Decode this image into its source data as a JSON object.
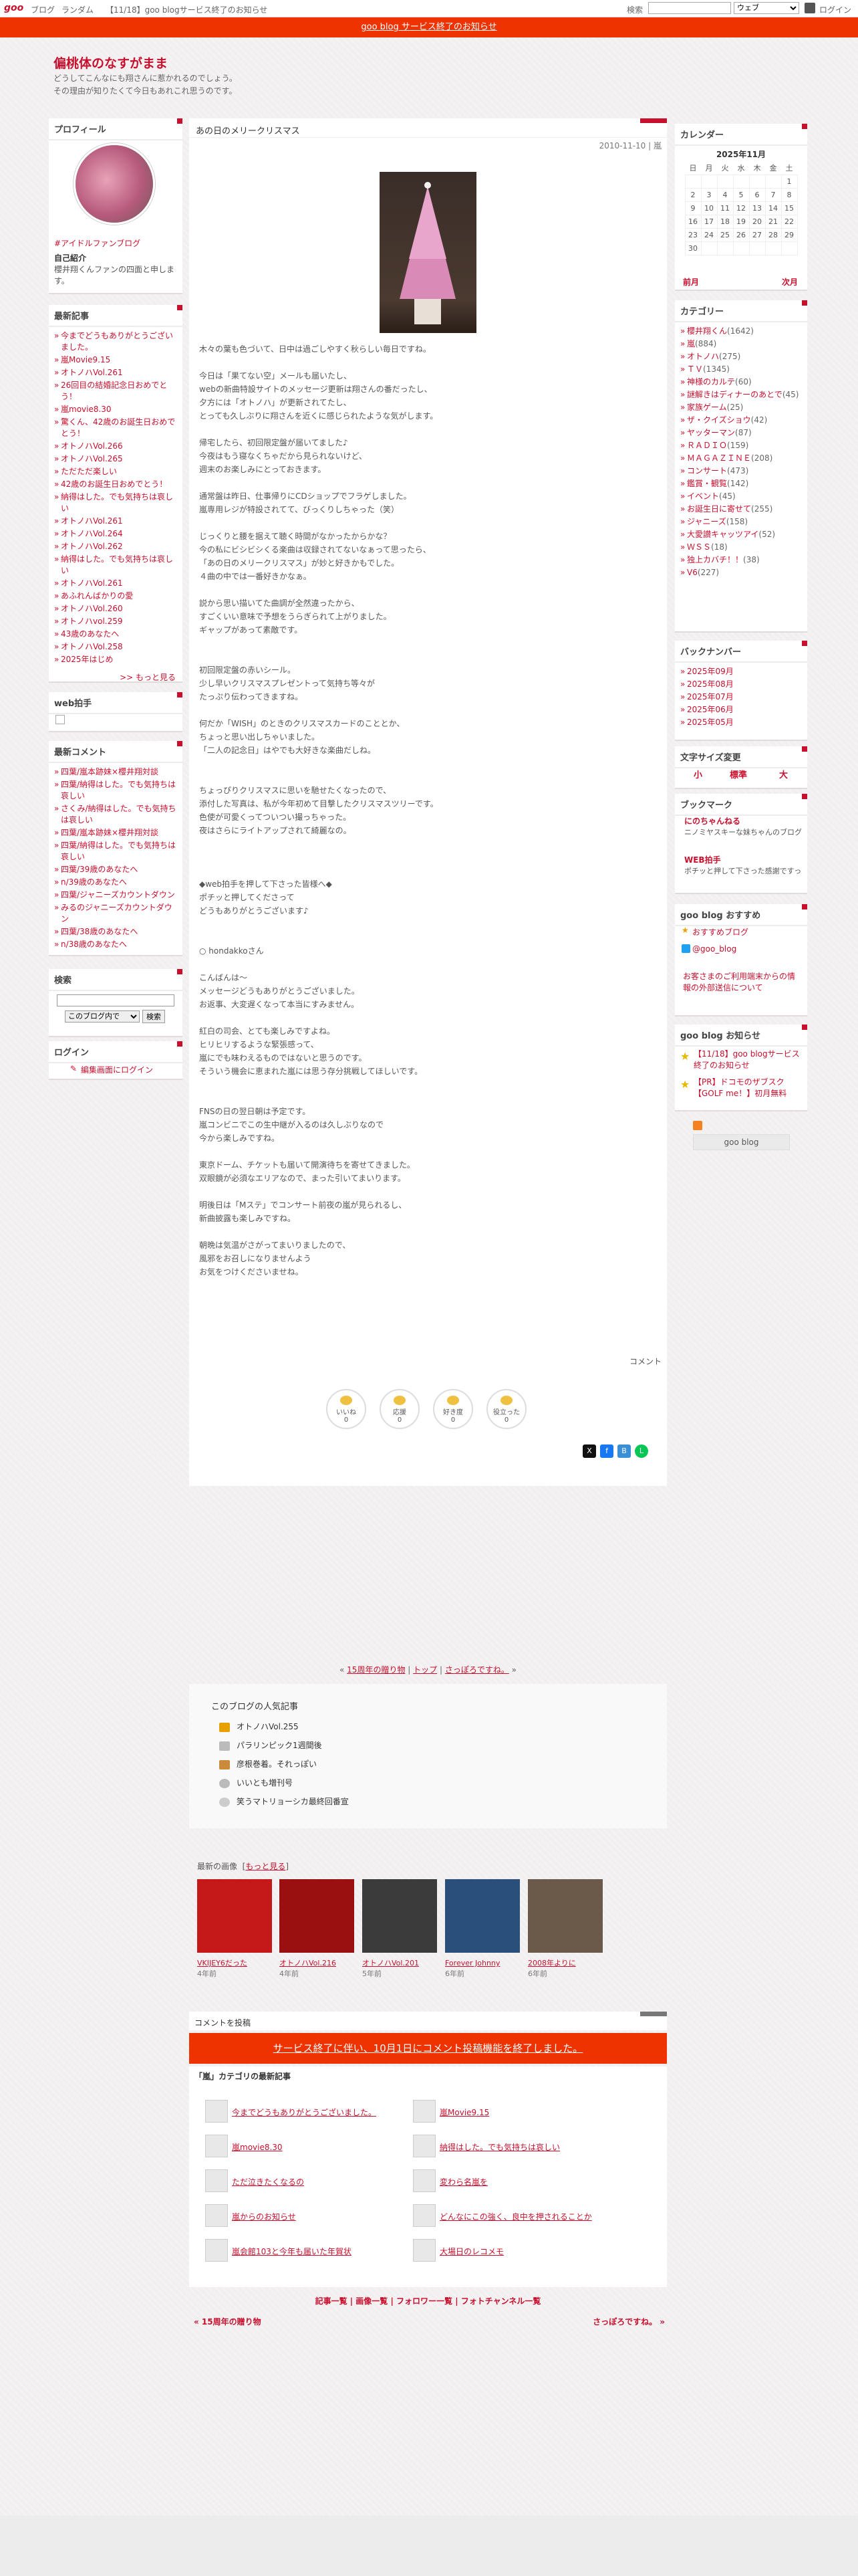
{
  "topbar": {
    "logo": "goo",
    "links": [
      "ブログ",
      "ランダム",
      "【11/18】goo blogサービス終了のお知らせ"
    ],
    "search_label": "検索",
    "scope": "ウェブ",
    "login": "ログイン"
  },
  "notice": "goo blog サービス終了のお知らせ",
  "blog": {
    "title": "偏桃体のなすがまま",
    "desc1": "どうしてこんなにも翔さんに惹かれるのでしょう。",
    "desc2": "その理由が知りたくて今日もあれこれ思うのです。"
  },
  "profile": {
    "heading": "プロフィール",
    "name": "#アイドルファンブログ",
    "intro_h": "自己紹介",
    "intro": "櫻井翔くんファンの四面と申します。"
  },
  "recent": {
    "heading": "最新記事",
    "items": [
      "今までどうもありがとうございました。",
      "嵐Movie9.15",
      "オトノハVol.261",
      "26回目の結婚記念日おめでとう！",
      "嵐movie8.30",
      "驚くん、42歳のお誕生日おめでとう！",
      "オトノハVol.266",
      "オトノハVol.265",
      "ただただ楽しい",
      "42歳のお誕生日おめでとう！",
      "納得はした。でも気持ちは哀しい",
      "オトノハVol.261",
      "オトノハVol.264",
      "オトノハVol.262",
      "納得はした。でも気持ちは哀しい",
      "オトノハVol.261",
      "あふれんばかりの愛",
      "オトノハVol.260",
      "オトノハvol.259",
      "43歳のあなたへ",
      "オトノハVol.258",
      "2025年はじめ"
    ],
    "more": ">> もっと見る"
  },
  "webclap": {
    "heading": "web拍手"
  },
  "comments": {
    "heading": "最新コメント",
    "items": [
      "四葉/嵐本跡妹×櫻井翔対談",
      "四葉/納得はした。でも気持ちは哀しい",
      "さくみ/納得はした。でも気持ちは哀しい",
      "四葉/嵐本跡妹×櫻井翔対談",
      "四葉/納得はした。でも気持ちは哀しい",
      "四葉/39歳のあなたへ",
      "n/39歳のあなたへ",
      "四葉/ジャニーズカウントダウン",
      "みるのジャニーズカウントダウン",
      "四葉/38歳のあなたへ",
      "n/38歳のあなたへ"
    ]
  },
  "search": {
    "heading": "検索",
    "scope": "このブログ内で",
    "button": "検索"
  },
  "login": {
    "heading": "ログイン",
    "link": "編集画面にログイン"
  },
  "entry": {
    "title": "あの日のメリークリスマス",
    "date": "2010-11-10 | 嵐",
    "body": [
      "木々の葉も色づいて、日中は過ごしやすく秋らしい毎日ですね。",
      "",
      "今日は「果てない空」メールも届いたし、",
      "webの新曲特設サイトのメッセージ更新は翔さんの番だったし、",
      "夕方には「オトノハ」が更新されてたし、",
      "とっても久しぶりに翔さんを近くに感じられたような気がします。",
      "",
      "帰宅したら、初回限定盤が届いてました♪",
      "今夜はもう寝なくちゃだから見られないけど、",
      "週末のお楽しみにとっておきます。",
      "",
      "通常盤は昨日、仕事帰りにCDショップでフラゲしました。",
      "嵐専用レジが特設されてて、びっくりしちゃった（笑）",
      "",
      "じっくりと腰を据えて聴く時間がなかったからかな？",
      "今の私にビシビシくる楽曲は収録されてないなぁって思ったら、",
      "「あの日のメリークリスマス」が妙と好きかもでした。",
      "４曲の中では一番好きかなぁ。",
      "",
      "説から思い描いてた曲調が全然違ったから、",
      "すごくいい意味で予想をうらぎられて上がりました。",
      "ギャップがあって素敵です。",
      "",
      "",
      "初回限定盤の赤いシール。",
      "少し早いクリスマスプレゼントって気持ち等々が",
      "たっぷり伝わってきますね。",
      "",
      "何だか「WISH」のときのクリスマスカードのこととか、",
      "ちょっと思い出しちゃいました。",
      "「二人の記念日」はやでも大好きな楽曲だしね。",
      "",
      "",
      "ちょっぴりクリスマスに思いを馳せたくなったので、",
      "添付した写真は、私が今年初めて目撃したクリスマスツリーです。",
      "色使が可愛くってついつい撮っちゃった。",
      "夜はさらにライトアップされて綺麗なの。",
      "",
      "",
      "",
      "◆web拍手を押して下さった皆様へ◆",
      "ポチッと押してくださって",
      "どうもありがとうございます♪",
      "",
      "",
      "○ hondakkoさん",
      "",
      "こんばんは～",
      "メッセージどうもありがとうございました。",
      "お返事、大変遅くなって本当にすみません。",
      "",
      "紅白の司会、とても楽しみですよね。",
      "ヒリヒリするような緊張感って、",
      "嵐にでも味わえるものではないと思うのです。",
      "そういう機会に恵まれた嵐には思う存分挑戦してほしいです。",
      "",
      "",
      "FNSの日の翌日朝は予定です。",
      "嵐コンビニでこの生中継が入るのは久しぶりなので",
      "今から楽しみですね。",
      "",
      "東京ドーム、チケットも届いて開演待ちを寄せてきました。",
      "双眼鏡が必須なエリアなので、まった引いてまいります。",
      "",
      "明後日は「Mステ」でコンサート前夜の嵐が見られるし、",
      "新曲披露も楽しみですね。",
      "",
      "朝晩は気温がさがってまいりましたので、",
      "風邪をお召しになりませんよう",
      "お気をつけくださいませね。"
    ],
    "comment_link": "コメント",
    "reactions": [
      "いいね",
      "応援",
      "好き度",
      "役立った"
    ],
    "reaction_counts": [
      "0",
      "0",
      "0",
      "0"
    ]
  },
  "pager": {
    "prev": "15周年の贈り物",
    "top": "トップ",
    "next": "さっぽろですね。"
  },
  "popular": {
    "heading": "このブログの人気記事",
    "items": [
      "オトノハVol.255",
      "パラリンピック1週間後",
      "彦根巻着。それっぽい",
      "いいとも増刊号",
      "笑うマトリョーシカ最終回番宣"
    ]
  },
  "images": {
    "heading": "最新の画像",
    "more": "もっと見る",
    "items": [
      {
        "t": "VKIJEY6だった",
        "a": "4年前"
      },
      {
        "t": "オトノハVol.216",
        "a": "4年前"
      },
      {
        "t": "オトノハVol.201",
        "a": "5年前"
      },
      {
        "t": "Forever Johnny",
        "a": "6年前"
      },
      {
        "t": "2008年よりに",
        "a": "6年前"
      }
    ]
  },
  "comment_post": {
    "heading": "コメントを投稿",
    "closed": "サービス終了に伴い、10月1日にコメント投稿機能を終了しました。"
  },
  "latest": {
    "heading": "「嵐」カテゴリの最新記事",
    "items": [
      "今までどうもありがとうございました。",
      "嵐Movie9.15",
      "嵐movie8.30",
      "納得はした。でも気持ちは哀しい",
      "ただ泣きたくなるの",
      "変わら名嵐を",
      "嵐からのお知らせ",
      "どんなにこの強く、良中を押されることか",
      "嵐会館103と今年も届いた年賀状",
      "大場日のレコメモ"
    ]
  },
  "footer": {
    "links": "記事一覧 | 画像一覧 | フォロワー一覧 | フォトチャンネル一覧",
    "prev": "« 15周年の贈り物",
    "next": "さっぽろですね。 »"
  },
  "calendar": {
    "heading": "カレンダー",
    "month": "2025年11月",
    "dow": [
      "日",
      "月",
      "火",
      "水",
      "木",
      "金",
      "土"
    ],
    "rows": [
      [
        "",
        "",
        "",
        "",
        "",
        "",
        "1"
      ],
      [
        "2",
        "3",
        "4",
        "5",
        "6",
        "7",
        "8"
      ],
      [
        "9",
        "10",
        "11",
        "12",
        "13",
        "14",
        "15"
      ],
      [
        "16",
        "17",
        "18",
        "19",
        "20",
        "21",
        "22"
      ],
      [
        "23",
        "24",
        "25",
        "26",
        "27",
        "28",
        "29"
      ],
      [
        "30",
        "",
        "",
        "",
        "",
        "",
        ""
      ]
    ],
    "prev": "前月",
    "next": "次月"
  },
  "categories": {
    "heading": "カテゴリー",
    "items": [
      [
        "櫻井翔くん",
        "1642"
      ],
      [
        "嵐",
        "884"
      ],
      [
        "オトノハ",
        "275"
      ],
      [
        "ＴＶ",
        "1345"
      ],
      [
        "神様のカルテ",
        "60"
      ],
      [
        "謎解きはディナーのあとで",
        "45"
      ],
      [
        "家族ゲーム",
        "25"
      ],
      [
        "ザ・クイズショウ",
        "42"
      ],
      [
        "ヤッターマン",
        "87"
      ],
      [
        "ＲＡＤＩＯ",
        "159"
      ],
      [
        "ＭＡＧＡＺＩＮＥ",
        "208"
      ],
      [
        "コンサート",
        "473"
      ],
      [
        "鑑賞・観覧",
        "142"
      ],
      [
        "イベント",
        "45"
      ],
      [
        "お誕生日に寄せて",
        "255"
      ],
      [
        "ジャニーズ",
        "158"
      ],
      [
        "大愛讃キャッツアイ",
        "52"
      ],
      [
        "ＷＳＳ",
        "18"
      ],
      [
        "独上カバチ！！",
        "38"
      ],
      [
        "V6",
        "227"
      ]
    ]
  },
  "backnumber": {
    "heading": "バックナンバー",
    "items": [
      "2025年09月",
      "2025年08月",
      "2025年07月",
      "2025年06月",
      "2025年05月"
    ]
  },
  "fontsize": {
    "heading": "文字サイズ変更",
    "small": "小",
    "mid": "標準",
    "large": "大"
  },
  "bookmark": {
    "heading": "ブックマーク",
    "b1t": "にのちゃんねる",
    "b1d": "ニノミヤスキーな妹ちゃんのブログ",
    "b2t": "WEB拍手",
    "b2d": "ポチッと押して下さった感謝ですっ"
  },
  "recommend": {
    "heading": "goo blog おすすめ",
    "i1": "おすすめブログ",
    "i2": "@goo_blog",
    "note": "お客さまのご利用端末からの情報の外部送信について"
  },
  "news": {
    "heading": "goo blog お知らせ",
    "n1": "【11/18】goo blogサービス終了のお知らせ",
    "n2": "【PR】ドコモのザブスク【GOLF me！】初月無料"
  },
  "badge": "goo blog"
}
